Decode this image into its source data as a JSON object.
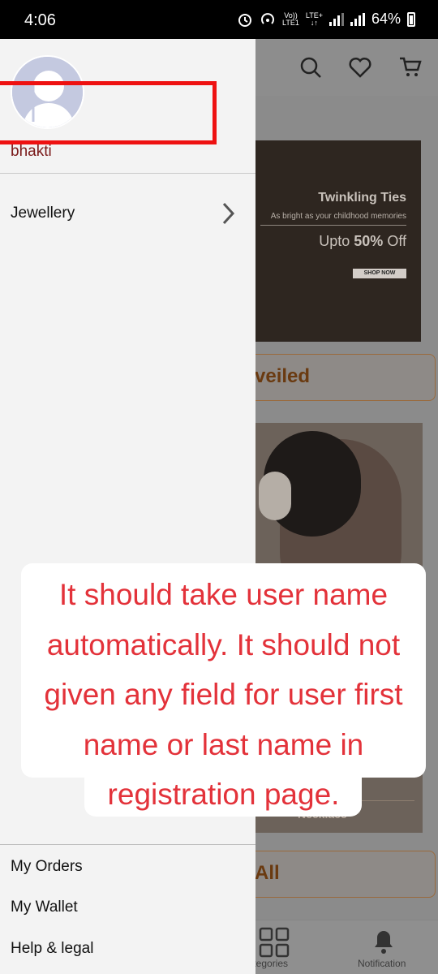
{
  "status_bar": {
    "time": "4:06",
    "network_top": "Vo))",
    "network_bottom": "LTE1",
    "lte_label": "LTE+",
    "battery": "64%"
  },
  "background_app": {
    "banner1": {
      "title": "Twinkling Ties",
      "subtitle": "As bright as your childhood memories",
      "offer_prefix": "Upto ",
      "offer_value": "50%",
      "offer_suffix": " Off",
      "cta": "SHOP NOW"
    },
    "pill1": "veiled",
    "banner2_caption": "Necklace",
    "pill2": "All",
    "bottom_nav": {
      "categories": "Categories",
      "notification": "Notification"
    }
  },
  "drawer": {
    "username": "bhakti",
    "menu": [
      {
        "label": "Jewellery"
      }
    ],
    "footer_menu": [
      {
        "label": "My Orders"
      },
      {
        "label": "My Wallet"
      },
      {
        "label": "Help & legal"
      }
    ]
  },
  "annotation": {
    "text": "It should take user name automatically. It should not given any field for user first name or last name in registration page."
  },
  "colors": {
    "annotation_red": "#e3323a",
    "highlight_red": "#ee1111",
    "username": "#7a1a1a"
  }
}
